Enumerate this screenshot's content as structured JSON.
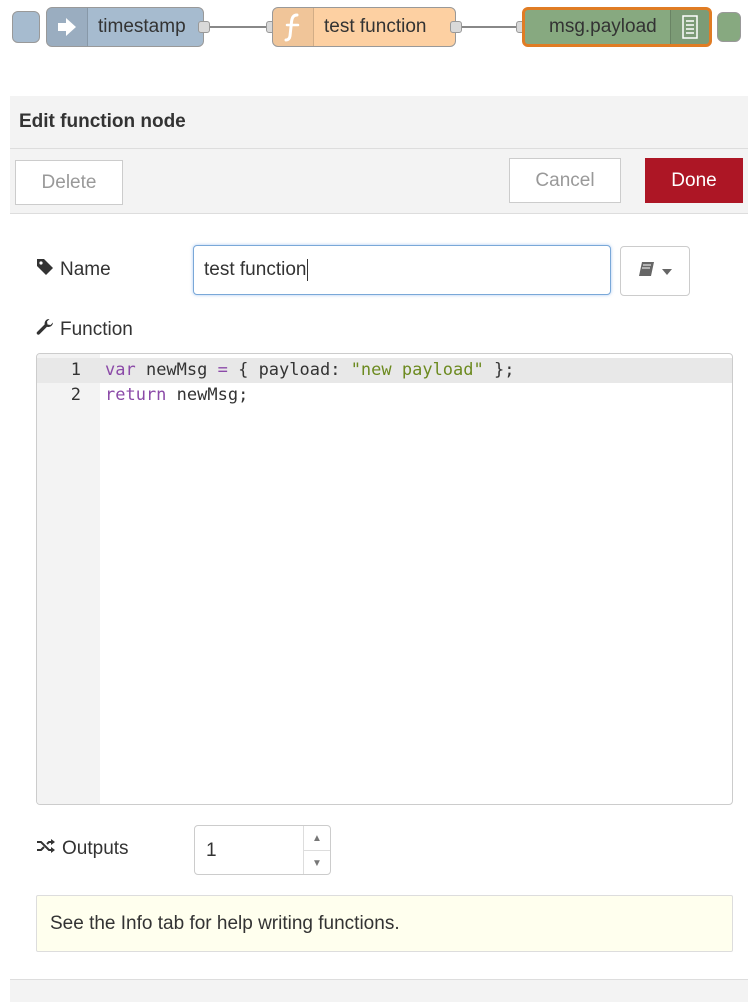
{
  "flow": {
    "nodes": [
      {
        "label": "timestamp",
        "icon": "arrow-right-icon",
        "color": "#a6bbcf"
      },
      {
        "label": "test function",
        "icon": "function-icon",
        "color": "#fdd0a2"
      },
      {
        "label": "msg.payload",
        "icon": "list-icon",
        "color": "#87a980"
      }
    ]
  },
  "tray": {
    "title": "Edit function node",
    "buttons": {
      "delete": "Delete",
      "cancel": "Cancel",
      "done": "Done"
    },
    "name_label": "Name",
    "name_value": "test function",
    "function_label": "Function",
    "code": [
      {
        "number": "1",
        "tokens": [
          {
            "t": "var",
            "c": "kw"
          },
          {
            "t": " newMsg ",
            "c": ""
          },
          {
            "t": "=",
            "c": "op"
          },
          {
            "t": " { payload: ",
            "c": ""
          },
          {
            "t": "\"new payload\"",
            "c": "str"
          },
          {
            "t": " };",
            "c": ""
          }
        ]
      },
      {
        "number": "2",
        "tokens": [
          {
            "t": "return",
            "c": "kw"
          },
          {
            "t": " newMsg;",
            "c": ""
          }
        ]
      }
    ],
    "outputs_label": "Outputs",
    "outputs_value": "1",
    "tip": "See the Info tab for help writing functions."
  },
  "colors": {
    "done": "#ad1625",
    "selected_border": "#e07c24",
    "tip_bg": "#ffffee"
  }
}
